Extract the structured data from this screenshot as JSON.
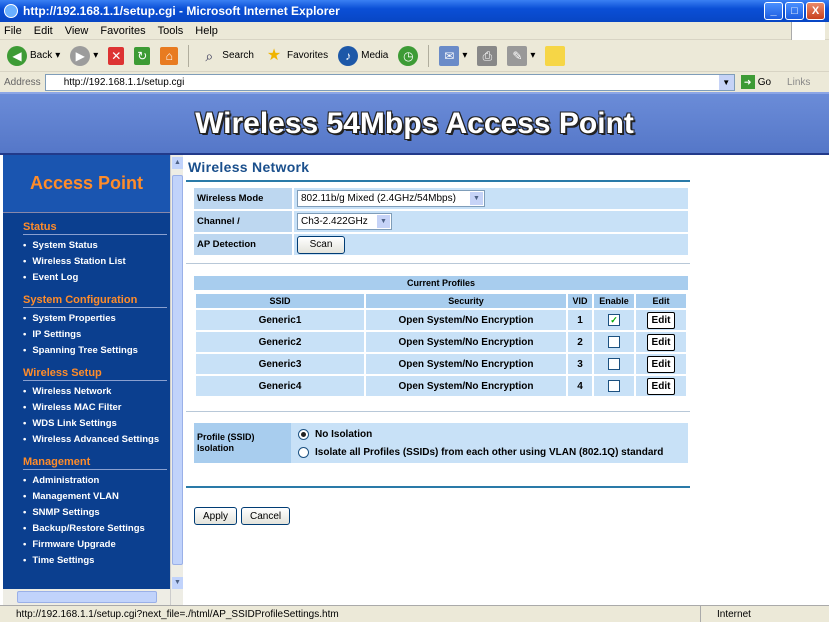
{
  "window": {
    "title": "http://192.168.1.1/setup.cgi - Microsoft Internet Explorer",
    "min": "_",
    "max": "□",
    "close": "X"
  },
  "menu": [
    "File",
    "Edit",
    "View",
    "Favorites",
    "Tools",
    "Help"
  ],
  "toolbar": {
    "back": "Back",
    "search": "Search",
    "favorites": "Favorites",
    "media": "Media"
  },
  "address": {
    "label": "Address",
    "url": "http://192.168.1.1/setup.cgi",
    "go": "Go",
    "links": "Links"
  },
  "banner": {
    "title": "Wireless 54Mbps Access Point"
  },
  "sidebar": {
    "heading": "Access Point",
    "sections": [
      {
        "title": "Status",
        "items": [
          "System Status",
          "Wireless Station List",
          "Event Log"
        ]
      },
      {
        "title": "System Configuration",
        "items": [
          "System Properties",
          "IP Settings",
          "Spanning Tree Settings"
        ]
      },
      {
        "title": "Wireless Setup",
        "items": [
          "Wireless Network",
          "Wireless MAC Filter",
          "WDS Link Settings",
          "Wireless Advanced Settings"
        ]
      },
      {
        "title": "Management",
        "items": [
          "Administration",
          "Management VLAN",
          "SNMP Settings",
          "Backup/Restore Settings",
          "Firmware Upgrade",
          "Time Settings"
        ]
      }
    ]
  },
  "main": {
    "title": "Wireless Network",
    "wireless_mode": {
      "label": "Wireless Mode",
      "value": "802.11b/g Mixed (2.4GHz/54Mbps)"
    },
    "channel": {
      "label": "Channel / Frequency",
      "value": "Ch3-2.422GHz"
    },
    "ap_detection": {
      "label": "AP Detection",
      "button": "Scan"
    },
    "profiles": {
      "heading": "Current Profiles",
      "columns": [
        "SSID",
        "Security",
        "VID",
        "Enable",
        "Edit"
      ],
      "rows": [
        {
          "ssid": "Generic1",
          "security": "Open System/No Encryption",
          "vid": "1",
          "enabled": true,
          "edit": "Edit"
        },
        {
          "ssid": "Generic2",
          "security": "Open System/No Encryption",
          "vid": "2",
          "enabled": false,
          "edit": "Edit"
        },
        {
          "ssid": "Generic3",
          "security": "Open System/No Encryption",
          "vid": "3",
          "enabled": false,
          "edit": "Edit"
        },
        {
          "ssid": "Generic4",
          "security": "Open System/No Encryption",
          "vid": "4",
          "enabled": false,
          "edit": "Edit"
        }
      ]
    },
    "isolation": {
      "label": "Profile (SSID) Isolation",
      "options": [
        "No Isolation",
        "Isolate all Profiles (SSIDs) from each other using VLAN (802.1Q) standard"
      ],
      "selected": 0
    },
    "apply": "Apply",
    "cancel": "Cancel"
  },
  "status": {
    "text": "http://192.168.1.1/setup.cgi?next_file=./html/AP_SSIDProfileSettings.htm",
    "zone": "Internet"
  }
}
